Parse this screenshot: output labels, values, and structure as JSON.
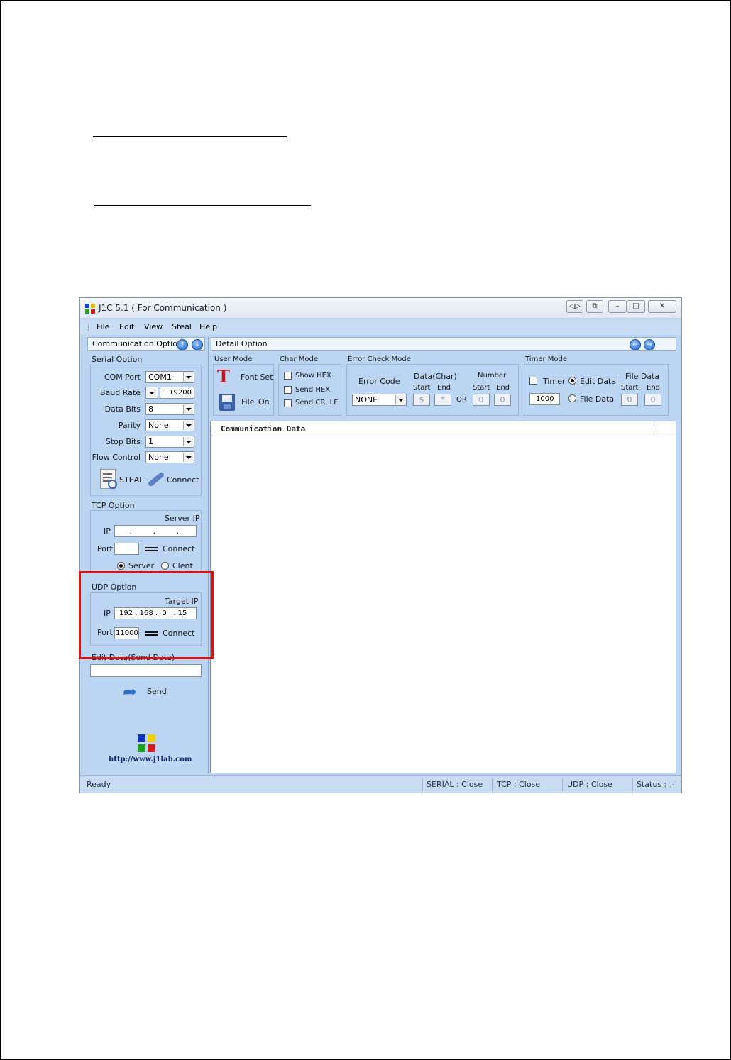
{
  "window": {
    "title": "J1C 5.1 ( For Communication )"
  },
  "menu": [
    "File",
    "Edit",
    "View",
    "Steal",
    "Help"
  ],
  "left_panel": {
    "title": "Communication Option",
    "serial": {
      "heading": "Serial Option",
      "com_port_label": "COM Port",
      "com_port": "COM1",
      "baud_label": "Baud Rate",
      "baud": "19200",
      "data_bits_label": "Data Bits",
      "data_bits": "8",
      "parity_label": "Parity",
      "parity": "None",
      "stop_bits_label": "Stop Bits",
      "stop_bits": "1",
      "flow_label": "Flow Control",
      "flow": "None",
      "steal_label": "STEAL",
      "connect_label": "Connect"
    },
    "tcp": {
      "heading": "TCP Option",
      "server_ip_label": "Server IP",
      "ip_label": "IP",
      "ip_value": "   .     .     .",
      "port_label": "Port",
      "connect_label": "Connect",
      "server_label": "Server",
      "client_label": "Clent"
    },
    "udp": {
      "heading": "UDP Option",
      "target_ip_label": "Target IP",
      "ip_label": "IP",
      "ip_value": "192 . 168 .  0   . 15",
      "port_label": "Port",
      "port_value": "11000",
      "connect_label": "Connect"
    },
    "edit": {
      "heading": "Edit Data(Send Data)",
      "send_label": "Send"
    },
    "url": "http://www.j1lab.com"
  },
  "detail": {
    "title": "Detail Option",
    "user_mode": {
      "heading": "User Mode",
      "font_set": "Font Set",
      "file": "File",
      "on": "On"
    },
    "char_mode": {
      "heading": "Char Mode",
      "show_hex": "Show HEX",
      "send_hex": "Send HEX",
      "send_crlf": "Send CR, LF"
    },
    "error_check": {
      "heading": "Error Check Mode",
      "error_code_label": "Error Code",
      "error_code": "NONE",
      "data_char_label": "Data(Char)",
      "number_label": "Number",
      "start": "Start",
      "end": "End",
      "or": "OR",
      "data_start": "$",
      "data_end": "*",
      "num_start": "0",
      "num_end": "0"
    },
    "timer_mode": {
      "heading": "Timer Mode",
      "timer_label": "Timer",
      "timer_value": "1000",
      "edit_data": "Edit Data",
      "file_data": "File Data",
      "file_data_head": "File Data",
      "start": "Start",
      "end": "End",
      "fd_start": "0",
      "fd_end": "0"
    }
  },
  "comm": {
    "header": "Communication Data"
  },
  "status": {
    "ready": "Ready",
    "serial": "SERIAL : Close",
    "tcp": "TCP : Close",
    "udp": "UDP : Close",
    "status": "Status :"
  },
  "colors": {
    "highlight_box": "#e01010",
    "window_bg": "#bcd5f2"
  }
}
